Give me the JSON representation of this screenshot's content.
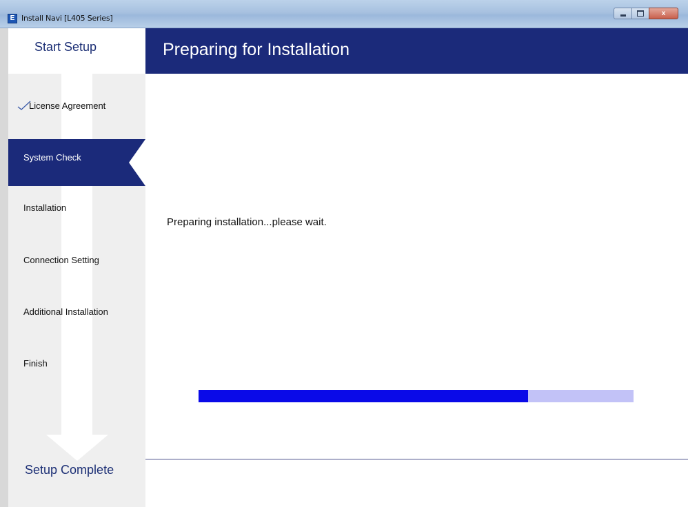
{
  "window": {
    "app_icon_glyph": "E",
    "title": "Install Navi [L405 Series]",
    "close_glyph": "x"
  },
  "sidebar": {
    "start_label": "Start Setup",
    "steps": [
      {
        "label": "License Agreement",
        "state": "done"
      },
      {
        "label": "System Check",
        "state": "active"
      },
      {
        "label": "Installation",
        "state": "pending"
      },
      {
        "label": "Connection Setting",
        "state": "pending"
      },
      {
        "label": "Additional Installation",
        "state": "pending"
      },
      {
        "label": "Finish",
        "state": "pending"
      }
    ],
    "end_label": "Setup Complete"
  },
  "main": {
    "title": "Preparing for Installation",
    "status": "Preparing installation...please wait.",
    "progress": 0.758
  },
  "colors": {
    "header_bg": "#1b2a7a",
    "progress_fill": "#0a0ae8",
    "progress_track": "#c2c2f7"
  }
}
